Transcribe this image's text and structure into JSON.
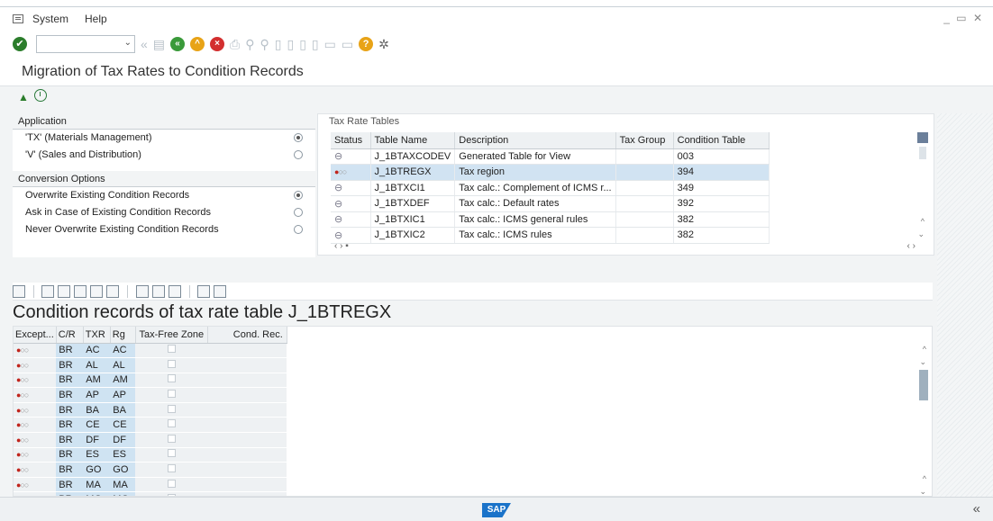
{
  "menu": {
    "system": "System",
    "help": "Help"
  },
  "toolbar": {
    "ok": "✔"
  },
  "title": "Migration of Tax Rates to Condition Records",
  "application": {
    "header": "Application",
    "options": [
      {
        "label": "'TX' (Materials Management)",
        "selected": true
      },
      {
        "label": "'V' (Sales and Distribution)",
        "selected": false
      }
    ]
  },
  "conversion": {
    "header": "Conversion Options",
    "options": [
      {
        "label": "Overwrite Existing Condition Records",
        "selected": true
      },
      {
        "label": "Ask in Case of Existing Condition Records",
        "selected": false
      },
      {
        "label": "Never Overwrite Existing Condition Records",
        "selected": false
      }
    ]
  },
  "tax_tables": {
    "title": "Tax Rate Tables",
    "columns": [
      "Status",
      "Table Name",
      "Description",
      "Tax Group",
      "Condition Table"
    ],
    "rows": [
      {
        "table": "J_1BTAXCODEV",
        "description": "Generated Table for View",
        "group": "",
        "cond": "003"
      },
      {
        "table": "J_1BTREGX",
        "description": "Tax region",
        "group": "",
        "cond": "394"
      },
      {
        "table": "J_1BTXCI1",
        "description": "Tax calc.: Complement of ICMS r...",
        "group": "",
        "cond": "349"
      },
      {
        "table": "J_1BTXDEF",
        "description": "Tax calc.: Default rates",
        "group": "",
        "cond": "392"
      },
      {
        "table": "J_1BTXIC1",
        "description": "Tax calc.: ICMS general rules",
        "group": "",
        "cond": "382"
      },
      {
        "table": "J_1BTXIC2",
        "description": "Tax calc.: ICMS rules",
        "group": "",
        "cond": "382"
      }
    ]
  },
  "records": {
    "title": "Condition records of tax rate table J_1BTREGX",
    "columns": [
      "Except...",
      "C/R",
      "TXR",
      "Rg",
      "Tax-Free Zone",
      "Cond. Rec."
    ],
    "rows": [
      {
        "cr": "BR",
        "txr": "AC",
        "rg": "AC"
      },
      {
        "cr": "BR",
        "txr": "AL",
        "rg": "AL"
      },
      {
        "cr": "BR",
        "txr": "AM",
        "rg": "AM"
      },
      {
        "cr": "BR",
        "txr": "AP",
        "rg": "AP"
      },
      {
        "cr": "BR",
        "txr": "BA",
        "rg": "BA"
      },
      {
        "cr": "BR",
        "txr": "CE",
        "rg": "CE"
      },
      {
        "cr": "BR",
        "txr": "DF",
        "rg": "DF"
      },
      {
        "cr": "BR",
        "txr": "ES",
        "rg": "ES"
      },
      {
        "cr": "BR",
        "txr": "GO",
        "rg": "GO"
      },
      {
        "cr": "BR",
        "txr": "MA",
        "rg": "MA"
      },
      {
        "cr": "BR",
        "txr": "MG",
        "rg": "MG"
      }
    ]
  },
  "status": {
    "logo": "SAP"
  }
}
